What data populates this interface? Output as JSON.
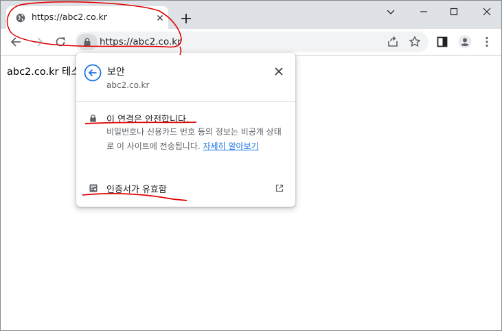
{
  "tab": {
    "title": "https://abc2.co.kr"
  },
  "omnibox": {
    "url": "https://abc2.co.kr"
  },
  "page": {
    "body_text": "abc2.co.kr 테스"
  },
  "security_popup": {
    "title": "보안",
    "site": "abc2.co.kr",
    "connection_heading": "이 연결은 안전합니다.",
    "connection_description": "비밀번호나 신용카드 번호 등의 정보는 비공개 상태로 이 사이트에 전송됩니다. ",
    "learn_more_link": "자세히 알아보기",
    "certificate_label": "인증서가 유효함"
  },
  "icons": {
    "tab_favicon": "globe-icon",
    "tab_close": "close-icon",
    "new_tab": "plus-icon",
    "back": "arrow-left-icon",
    "forward": "arrow-right-icon",
    "reload": "reload-icon",
    "site_info": "lock-icon",
    "share": "share-icon",
    "bookmark": "star-icon",
    "side_panel": "side-panel-icon",
    "profile": "profile-icon",
    "menu": "kebab-menu-icon"
  },
  "colors": {
    "tabstrip": "#dee1e6",
    "link": "#1a73e8",
    "annotation": "#e00000",
    "secondary_text": "#5f6368"
  }
}
